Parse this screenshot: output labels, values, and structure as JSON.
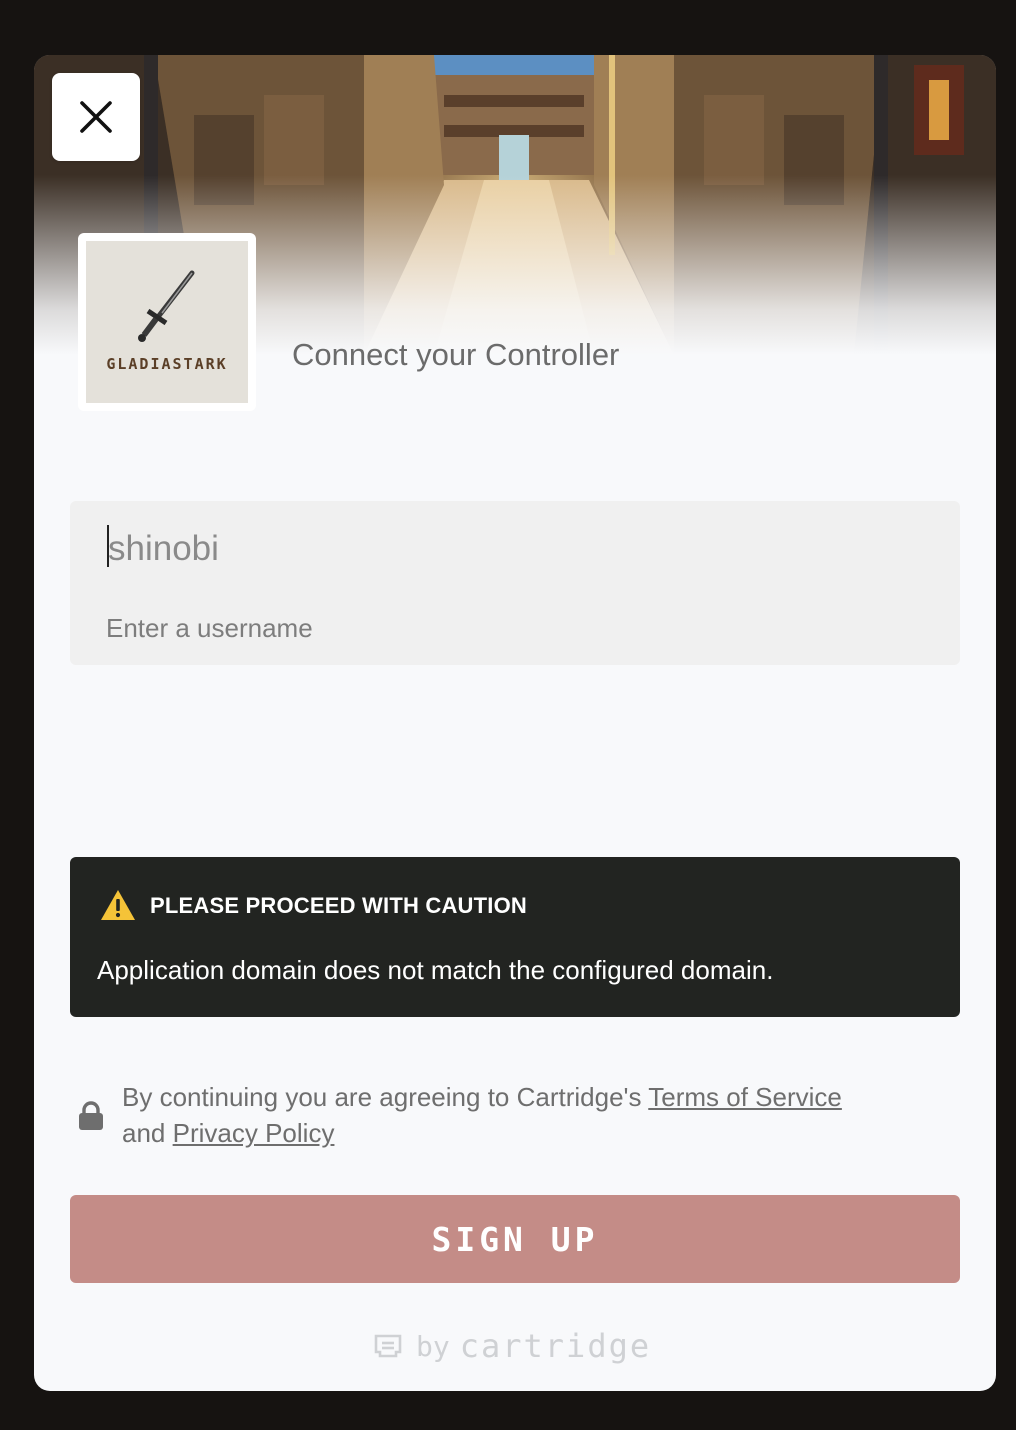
{
  "app": {
    "logo_text": "GLADIASTARK",
    "title": "Connect your Controller"
  },
  "username": {
    "value": "shinobi",
    "hint": "Enter a username"
  },
  "warning": {
    "title": "PLEASE PROCEED WITH CAUTION",
    "message": "Application domain does not match the configured domain.",
    "icon": "warning-triangle-icon",
    "icon_color": "#f5c338"
  },
  "terms": {
    "prefix": "By continuing you are agreeing to Cartridge's",
    "terms_link": "Terms of Service",
    "middle": "and",
    "privacy_link": "Privacy Policy"
  },
  "signup_button": {
    "label": "SIGN UP",
    "color": "#c48c87"
  },
  "footer": {
    "by": "by",
    "brand": "cartridge"
  }
}
